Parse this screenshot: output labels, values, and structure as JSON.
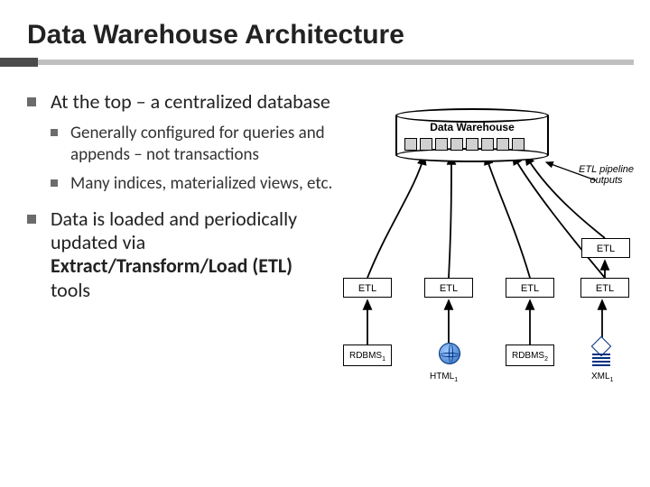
{
  "slide": {
    "title": "Data Warehouse Architecture",
    "bullets": [
      {
        "text": "At the top – a centralized database",
        "children": [
          {
            "text": "Generally configured for queries and appends – not transactions"
          },
          {
            "text": "Many indices, materialized views, etc."
          }
        ]
      },
      {
        "html": "Data is loaded and periodically updated via <b>Extract/Transform/Load (ETL)</b> tools"
      }
    ]
  },
  "diagram": {
    "warehouse_label": "Data Warehouse",
    "pipeline_label_line1": "ETL pipeline",
    "pipeline_label_line2": "outputs",
    "etl_label": "ETL",
    "sources": {
      "rdbms1": "RDBMS₁",
      "rdbms2": "RDBMS₂",
      "html1": "HTML₁",
      "xml1": "XML₁"
    }
  }
}
